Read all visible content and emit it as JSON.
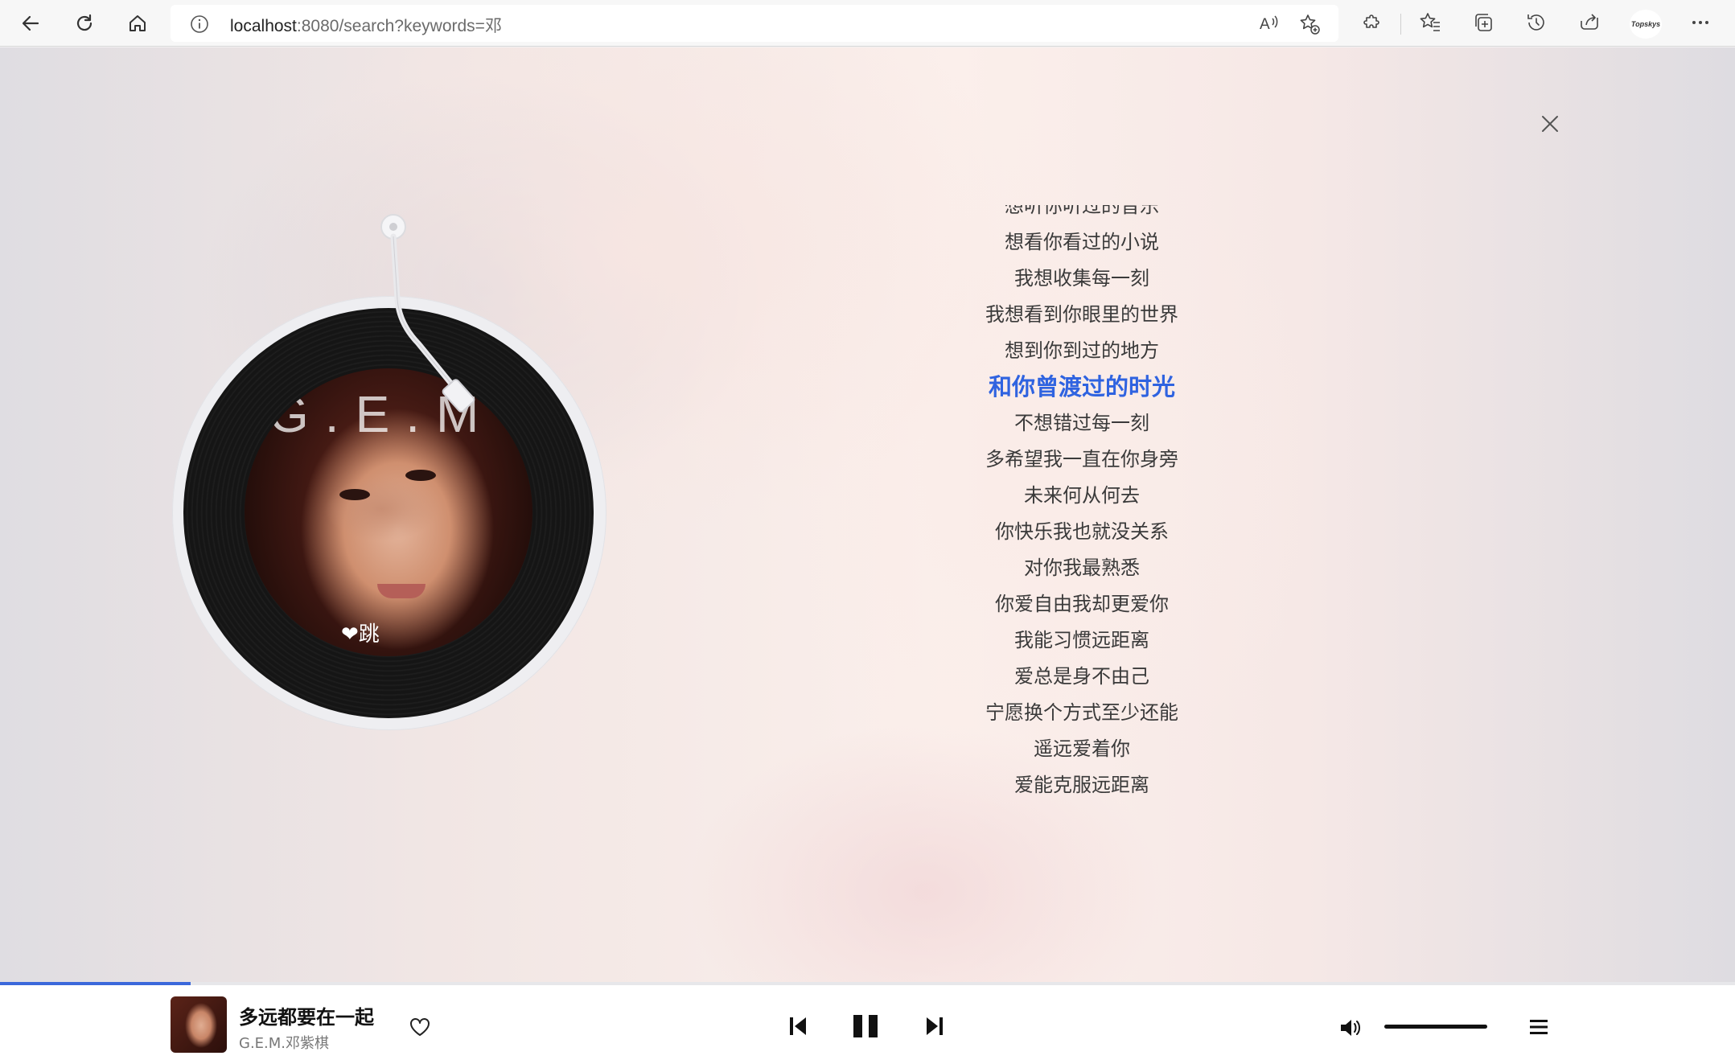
{
  "browser": {
    "url_host": "localhost",
    "url_path": ":8080/search?keywords=邓",
    "profile_label": "Topskys"
  },
  "lyrics": [
    "想听你听过的音乐",
    "想看你看过的小说",
    "我想收集每一刻",
    "我想看到你眼里的世界",
    "想到你到过的地方",
    "和你曾渡过的时光",
    "不想错过每一刻",
    "多希望我一直在你身旁",
    "未来何从何去",
    "你快乐我也就没关系",
    "对你我最熟悉",
    "你爱自由我却更爱你",
    "我能习惯远距离",
    "爱总是身不由己",
    "宁愿换个方式至少还能",
    "遥远爱着你",
    "爱能克服远距离"
  ],
  "active_lyric_index": 5,
  "cover": {
    "letters": "G.E.M",
    "tag": "❤跳"
  },
  "player": {
    "song_title": "多远都要在一起",
    "artist": "G.E.M.邓紫棋",
    "progress": 0.11,
    "volume": 1.0,
    "state": "playing"
  },
  "colors": {
    "accent": "#2f63e0",
    "progress": "#3b68db"
  },
  "icons": {
    "back": "back-arrow-icon",
    "refresh": "refresh-icon",
    "home": "home-icon",
    "info": "info-icon",
    "read_aloud": "read-aloud-icon",
    "add_favorite": "add-favorite-icon",
    "extensions": "extensions-icon",
    "favorites": "favorites-icon",
    "collections": "collections-icon",
    "history": "history-icon",
    "share": "share-icon",
    "more": "more-icon",
    "close": "close-icon",
    "heart": "heart-icon",
    "previous": "previous-icon",
    "pause": "pause-icon",
    "next": "next-icon",
    "volume": "volume-icon",
    "playlist": "playlist-icon"
  }
}
